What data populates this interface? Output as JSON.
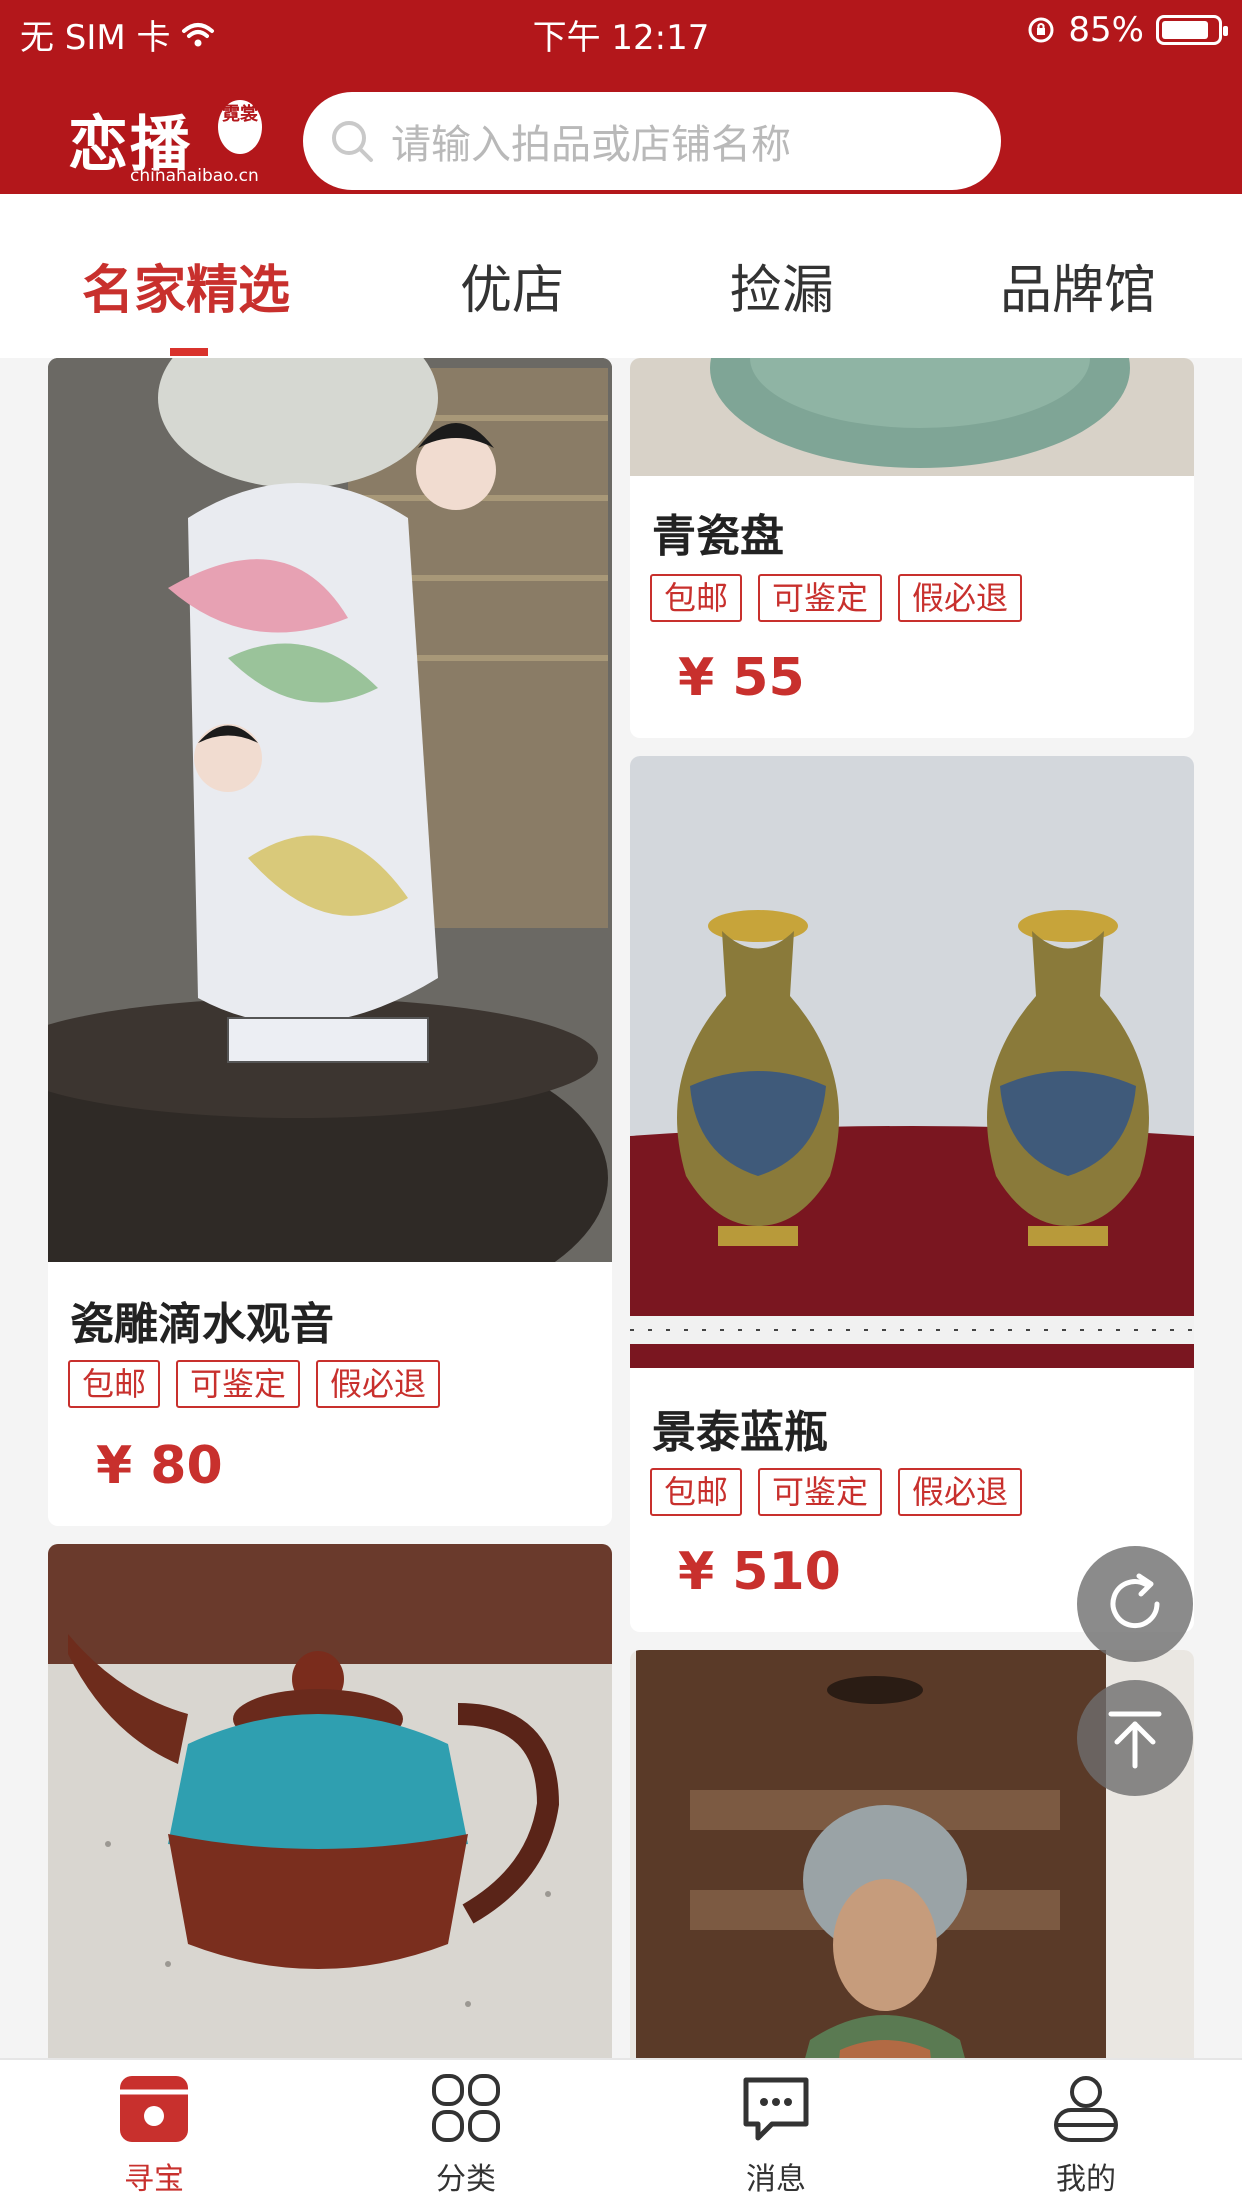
{
  "status_bar": {
    "carrier": "无 SIM 卡",
    "time": "下午 12:17",
    "battery": "85%",
    "battery_level": 0.85
  },
  "header": {
    "logo_text": "恋播",
    "logo_seal": "霓裳",
    "logo_domain": "chinahaibao.cn",
    "search_placeholder": "请输入拍品或店铺名称",
    "brand_color": "#b3171b"
  },
  "tabs": [
    {
      "label": "名家精选",
      "active": true
    },
    {
      "label": "优店",
      "active": false
    },
    {
      "label": "捡漏",
      "active": false
    },
    {
      "label": "品牌馆",
      "active": false
    }
  ],
  "products": [
    {
      "title": "瓷雕滴水观音",
      "badges": [
        "包邮",
        "可鉴定",
        "假必退"
      ],
      "price": "¥ 80",
      "image": "porcelain-guanyin-statue"
    },
    {
      "title": "青瓷盘",
      "badges": [
        "包邮",
        "可鉴定",
        "假必退"
      ],
      "price": "¥ 55",
      "image": "celadon-plate"
    },
    {
      "title": "景泰蓝瓶",
      "badges": [
        "包邮",
        "可鉴定",
        "假必退"
      ],
      "price": "¥ 510",
      "image": "cloisonne-vases"
    },
    {
      "title": "",
      "badges": [],
      "price": "",
      "image": "glazed-teapot"
    },
    {
      "title": "",
      "badges": [],
      "price": "",
      "image": "tang-lady-figurine"
    }
  ],
  "float_buttons": [
    "refresh-icon",
    "back-to-top-icon"
  ],
  "bottom_nav": [
    {
      "label": "寻宝",
      "icon": "treasure-icon",
      "active": true
    },
    {
      "label": "分类",
      "icon": "category-grid-icon",
      "active": false
    },
    {
      "label": "消息",
      "icon": "message-icon",
      "active": false
    },
    {
      "label": "我的",
      "icon": "user-icon",
      "active": false
    }
  ],
  "colors": {
    "accent": "#c8302d",
    "background": "#f4f4f4"
  }
}
